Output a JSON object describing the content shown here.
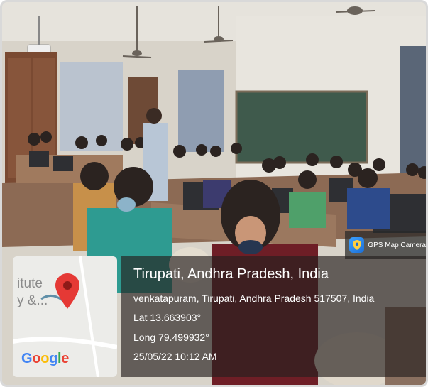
{
  "badge": {
    "label": "GPS Map Camera",
    "icon": "map-pin-camera-icon"
  },
  "map": {
    "place_text_1": "itute",
    "place_text_2": "y &...",
    "provider": [
      "G",
      "o",
      "o",
      "g",
      "l",
      "e"
    ],
    "pin_color": "#e53935"
  },
  "location": {
    "title": "Tirupati, Andhra Pradesh, India",
    "address": "venkatapuram, Tirupati, Andhra Pradesh 517507, India",
    "lat": "Lat 13.663903°",
    "long": "Long 79.499932°",
    "datetime": "25/05/22 10:12 AM"
  }
}
